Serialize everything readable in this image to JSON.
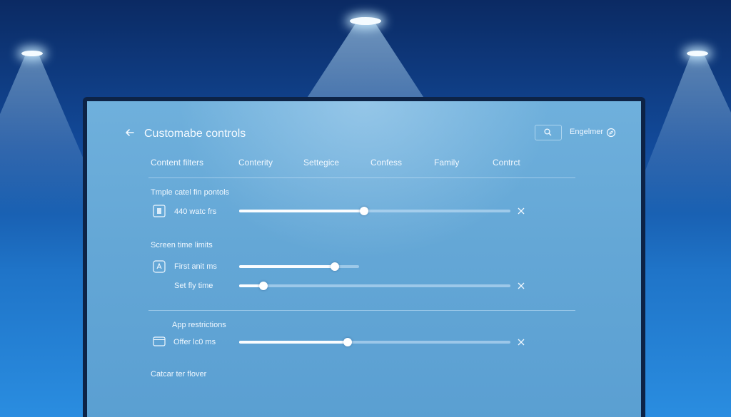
{
  "header": {
    "title": "Customabe controls",
    "language_label": "Engelmer"
  },
  "tabs": [
    {
      "label": "Content filters"
    },
    {
      "label": "Conterity"
    },
    {
      "label": "Settegice"
    },
    {
      "label": "Confess"
    },
    {
      "label": "Family"
    },
    {
      "label": "Contrct"
    }
  ],
  "sections": [
    {
      "title": "Tmple catel fin pontols",
      "rows": [
        {
          "label": "440 watc frs",
          "value_percent": 46,
          "icon": "document-icon",
          "closable": true
        }
      ]
    },
    {
      "title": "Screen time limits",
      "rows": [
        {
          "label": "First anit ms",
          "value_percent": 80,
          "icon": "app-tile-icon",
          "closable": false
        },
        {
          "label": "Set fly time",
          "value_percent": 9,
          "icon": "",
          "closable": true
        }
      ]
    },
    {
      "title": "App restrictions",
      "rows": [
        {
          "label": "Offer lc0 ms",
          "value_percent": 40,
          "icon": "window-icon",
          "closable": true
        }
      ]
    },
    {
      "title": "Catcar ter flover",
      "rows": []
    }
  ],
  "colors": {
    "background_top": "#0b2a63",
    "background_bottom": "#2a8de0",
    "screen": "#64a7d6",
    "slider_fill": "#fbfdff"
  }
}
